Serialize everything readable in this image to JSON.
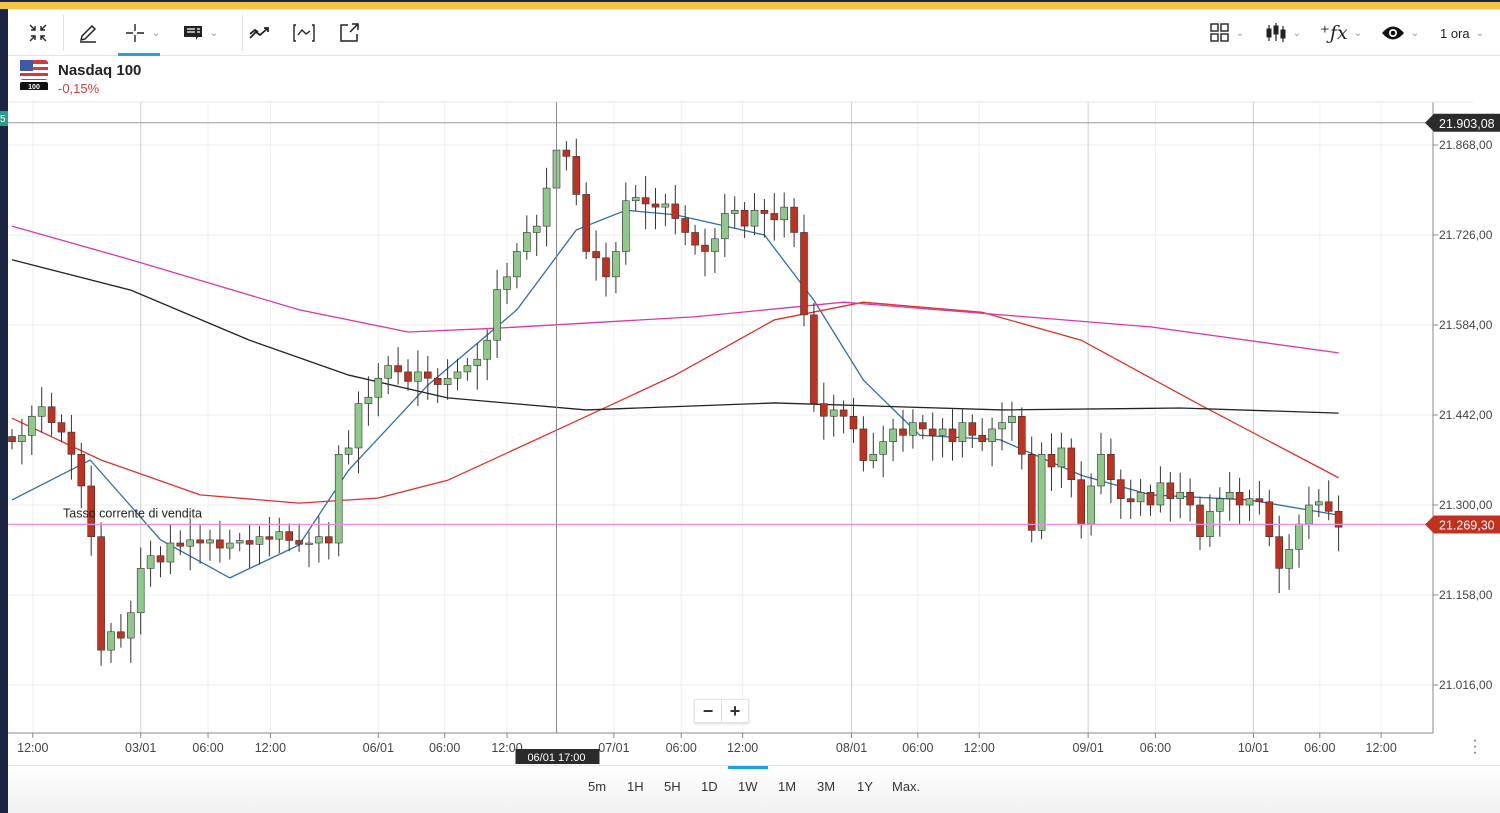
{
  "toolbar": {
    "timeframe": "1 ora",
    "left_tools": [
      "collapse-icon",
      "pencil-icon",
      "crosshair-icon",
      "annotation-icon",
      "trend-icon",
      "indicator-icon",
      "external-link-icon"
    ],
    "right_tools": [
      "layout-grid-icon",
      "candlestick-icon",
      "function-icon",
      "eye-icon"
    ]
  },
  "instrument": {
    "name": "Nasdaq 100",
    "change": "-0,15%",
    "flag_badge": "100"
  },
  "chart": {
    "type": "candlestick",
    "price_axis": {
      "min": 21016,
      "max": 21868,
      "ticks": [
        "21.868,00",
        "21.726,00",
        "21.584,00",
        "21.442,00",
        "21.300,00",
        "21.158,00",
        "21.016,00"
      ],
      "tick_values": [
        21868,
        21726,
        21584,
        21442,
        21300,
        21158,
        21016
      ]
    },
    "high_marker": {
      "label": "21.903,08",
      "value": 21903.08
    },
    "current_price": {
      "label": "21.269,30",
      "value": 21269.3,
      "caption": "Tasso corrente di vendita"
    },
    "left_tag": "5",
    "crosshair_label": "06/01 17:00",
    "crosshair_index": 55,
    "time_axis": [
      {
        "label": "12:00",
        "i": 2.1
      },
      {
        "label": "03/01",
        "i": 13
      },
      {
        "label": "06:00",
        "i": 19.8
      },
      {
        "label": "12:00",
        "i": 26.1
      },
      {
        "label": "06/01",
        "i": 37
      },
      {
        "label": "06:00",
        "i": 43.7
      },
      {
        "label": "12:00",
        "i": 50
      },
      {
        "label": "07/01",
        "i": 60.8
      },
      {
        "label": "06:00",
        "i": 67.6
      },
      {
        "label": "12:00",
        "i": 73.8
      },
      {
        "label": "08/01",
        "i": 84.8
      },
      {
        "label": "06:00",
        "i": 91.5
      },
      {
        "label": "12:00",
        "i": 97.7
      },
      {
        "label": "09/01",
        "i": 108.7
      },
      {
        "label": "06:00",
        "i": 115.5
      },
      {
        "label": "10/01",
        "i": 125.4
      },
      {
        "label": "06:00",
        "i": 132.1
      },
      {
        "label": "12:00",
        "i": 138.3
      }
    ],
    "major_days": [
      13,
      84.8,
      108.7,
      125.4
    ],
    "closes": [
      21400,
      21410,
      21440,
      21455,
      21430,
      21415,
      21380,
      21330,
      21250,
      21071,
      21100,
      21090,
      21130,
      21200,
      21220,
      21210,
      21240,
      21235,
      21245,
      21240,
      21245,
      21232,
      21240,
      21244,
      21238,
      21250,
      21246,
      21258,
      21244,
      21238,
      21240,
      21250,
      21240,
      21380,
      21390,
      21460,
      21470,
      21500,
      21520,
      21510,
      21495,
      21510,
      21500,
      21490,
      21500,
      21510,
      21520,
      21530,
      21560,
      21640,
      21660,
      21700,
      21730,
      21740,
      21800,
      21860,
      21850,
      21790,
      21700,
      21690,
      21660,
      21700,
      21780,
      21785,
      21775,
      21770,
      21775,
      21752,
      21730,
      21710,
      21700,
      21720,
      21760,
      21765,
      21740,
      21765,
      21760,
      21750,
      21770,
      21730,
      21600,
      21460,
      21440,
      21450,
      21440,
      21420,
      21370,
      21380,
      21400,
      21420,
      21410,
      21430,
      21420,
      21410,
      21420,
      21400,
      21430,
      21410,
      21400,
      21420,
      21430,
      21440,
      21380,
      21260,
      21380,
      21360,
      21390,
      21340,
      21270,
      21330,
      21380,
      21340,
      21310,
      21305,
      21320,
      21300,
      21335,
      21310,
      21320,
      21300,
      21250,
      21290,
      21310,
      21320,
      21300,
      21310,
      21305,
      21250,
      21200,
      21230,
      21270,
      21300,
      21305,
      21290,
      21265
    ],
    "moving_averages": [
      {
        "color": "#2f6fa8",
        "points": [
          [
            0,
            21308
          ],
          [
            7.9,
            21371
          ],
          [
            15,
            21245
          ],
          [
            22,
            21185
          ],
          [
            29,
            21237
          ],
          [
            34,
            21355
          ],
          [
            42,
            21489
          ],
          [
            51,
            21608
          ],
          [
            57,
            21734
          ],
          [
            62,
            21765
          ],
          [
            67,
            21758
          ],
          [
            76,
            21726
          ],
          [
            81,
            21623
          ],
          [
            86,
            21497
          ],
          [
            91.7,
            21410
          ],
          [
            99.8,
            21403
          ],
          [
            108,
            21347
          ],
          [
            115,
            21316
          ],
          [
            125,
            21308
          ],
          [
            134,
            21284
          ]
        ]
      },
      {
        "color": "#d9342b",
        "points": [
          [
            0,
            21437
          ],
          [
            9,
            21371
          ],
          [
            19,
            21316
          ],
          [
            29,
            21303
          ],
          [
            37,
            21311
          ],
          [
            44,
            21339
          ],
          [
            55,
            21418
          ],
          [
            67,
            21505
          ],
          [
            77,
            21592
          ],
          [
            86,
            21620
          ],
          [
            98,
            21604
          ],
          [
            108,
            21560
          ],
          [
            120,
            21458
          ],
          [
            134,
            21343
          ]
        ]
      },
      {
        "color": "#222222",
        "points": [
          [
            0,
            21687
          ],
          [
            12,
            21639
          ],
          [
            24,
            21560
          ],
          [
            34,
            21505
          ],
          [
            44,
            21469
          ],
          [
            58,
            21450
          ],
          [
            77,
            21461
          ],
          [
            100,
            21450
          ],
          [
            118,
            21453
          ],
          [
            134,
            21445
          ]
        ]
      },
      {
        "color": "#d63aa6",
        "points": [
          [
            0,
            21740
          ],
          [
            12,
            21687
          ],
          [
            29,
            21608
          ],
          [
            40,
            21573
          ],
          [
            49,
            21579
          ],
          [
            69,
            21597
          ],
          [
            84,
            21620
          ],
          [
            100,
            21600
          ],
          [
            115,
            21581
          ],
          [
            134,
            21540
          ]
        ]
      }
    ],
    "up_color": "#8fc98a",
    "down_color": "#c0311f"
  },
  "zoom": {
    "minus": "−",
    "plus": "+"
  },
  "ranges": [
    "5m",
    "1H",
    "5H",
    "1D",
    "1W",
    "1M",
    "3M",
    "1Y",
    "Max."
  ],
  "active_range": "1W"
}
